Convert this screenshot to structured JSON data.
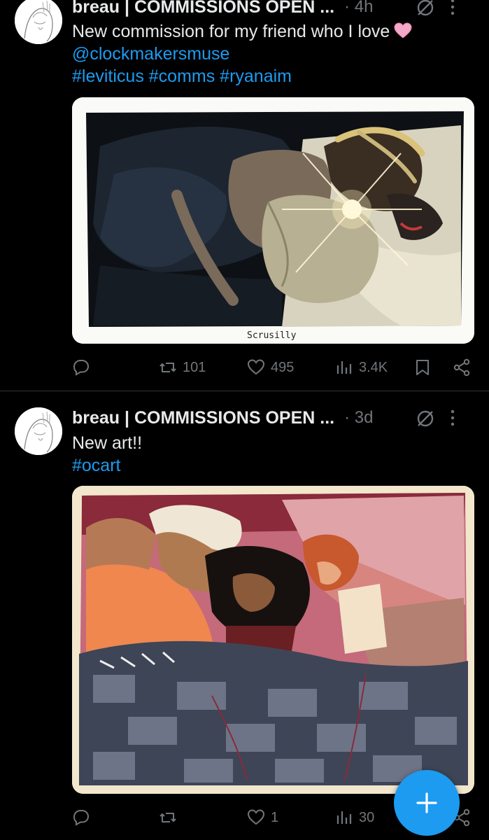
{
  "tweets": [
    {
      "author": "breau | COMMISSIONS OPEN ...",
      "time": "· 4h",
      "text": "New commission for my friend who I love",
      "mention": "@clockmakersmuse",
      "hashtags": "#leviticus #comms #ryanaim",
      "image_signature": "Scrusilly",
      "stats": {
        "replies": "",
        "reposts": "101",
        "likes": "495",
        "views": "3.4K"
      }
    },
    {
      "author": "breau | COMMISSIONS OPEN ...",
      "time": "· 3d",
      "text": "New art!!",
      "hashtags": "#ocart",
      "stats": {
        "replies": "",
        "reposts": "",
        "likes": "1",
        "views": "30"
      }
    }
  ],
  "icons": {
    "reply": "reply-icon",
    "repost": "repost-icon",
    "like": "heart-icon",
    "views": "views-icon",
    "bookmark": "bookmark-icon",
    "share": "share-icon",
    "grok": "grok-icon",
    "more": "more-icon",
    "compose": "compose-plus-icon"
  },
  "colors": {
    "accent": "#1d9bf0",
    "muted": "#71767b",
    "text": "#e7e9ea",
    "background": "#000000"
  }
}
